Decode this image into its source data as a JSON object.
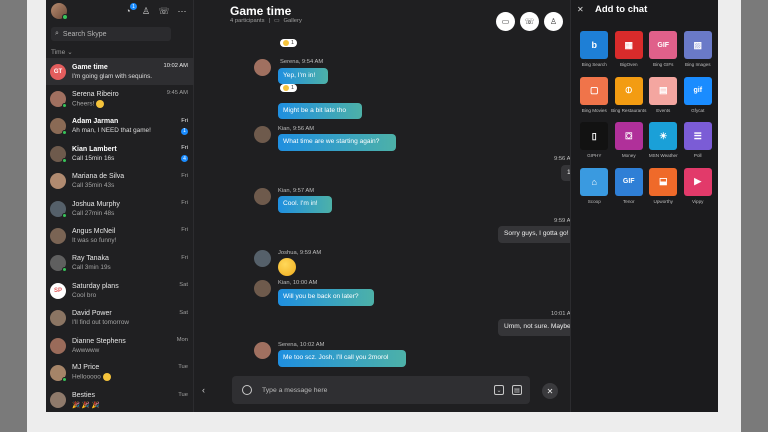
{
  "sidebar": {
    "search_placeholder": "Search Skype",
    "sort_label": "Time",
    "notification_count": "1",
    "chats": [
      {
        "name": "Game time",
        "preview": "I'm going glam with sequins.",
        "time": "10:02 AM",
        "initials": "GT",
        "avatar_color": "#e35d5d",
        "bold": true,
        "active": true,
        "badge": "",
        "online": false
      },
      {
        "name": "Serena Ribeiro",
        "preview": "Cheers!",
        "time": "9:45 AM",
        "initials": "",
        "avatar_color": "#a07060",
        "bold": false,
        "active": false,
        "badge": "",
        "online": true,
        "emoji": true
      },
      {
        "name": "Adam Jarman",
        "preview": "Ah man, I NEED that game!",
        "time": "Fri",
        "initials": "",
        "avatar_color": "#8a6a55",
        "bold": true,
        "active": false,
        "badge": "1",
        "online": true
      },
      {
        "name": "Kian Lambert",
        "preview": "Call 15min 16s",
        "time": "Fri",
        "initials": "",
        "avatar_color": "#6e5a4c",
        "bold": true,
        "active": false,
        "badge": "4",
        "online": true
      },
      {
        "name": "Mariana de Silva",
        "preview": "Call 35min 43s",
        "time": "Fri",
        "initials": "",
        "avatar_color": "#b08a70",
        "bold": false,
        "active": false,
        "badge": "",
        "online": false
      },
      {
        "name": "Joshua Murphy",
        "preview": "Call 27min 48s",
        "time": "Fri",
        "initials": "",
        "avatar_color": "#55606a",
        "bold": false,
        "active": false,
        "badge": "",
        "online": true
      },
      {
        "name": "Angus McNeil",
        "preview": "It was so funny!",
        "time": "Fri",
        "initials": "",
        "avatar_color": "#7a6454",
        "bold": false,
        "active": false,
        "badge": "",
        "online": false
      },
      {
        "name": "Ray Tanaka",
        "preview": "Call 3min 19s",
        "time": "Fri",
        "initials": "",
        "avatar_color": "#5f5f5f",
        "bold": false,
        "active": false,
        "badge": "",
        "online": true
      },
      {
        "name": "Saturday plans",
        "preview": "Cool bro",
        "time": "Sat",
        "initials": "SP",
        "avatar_color": "#ffffff",
        "bold": false,
        "active": false,
        "badge": "",
        "online": false,
        "initials_color": "#e35d5d"
      },
      {
        "name": "David Power",
        "preview": "I'll find out tomorrow",
        "time": "Sat",
        "initials": "",
        "avatar_color": "#8b7563",
        "bold": false,
        "active": false,
        "badge": "",
        "online": false
      },
      {
        "name": "Dianne Stephens",
        "preview": "Awwwww",
        "time": "Mon",
        "initials": "",
        "avatar_color": "#9a6b5a",
        "bold": false,
        "active": false,
        "badge": "",
        "online": false
      },
      {
        "name": "MJ Price",
        "preview": "Hellooooo",
        "time": "Tue",
        "initials": "",
        "avatar_color": "#a58468",
        "bold": false,
        "active": false,
        "badge": "",
        "online": true,
        "emoji": true
      },
      {
        "name": "Besties",
        "preview": "🎉 🎉 🎉",
        "time": "Tue",
        "initials": "",
        "avatar_color": "#8f7a6b",
        "bold": false,
        "active": false,
        "badge": "",
        "online": false
      }
    ]
  },
  "conversation": {
    "title": "Game time",
    "participants": "4 participants",
    "gallery": "Gallery",
    "composer_placeholder": "Type a message here",
    "reaction_count": "1",
    "messages": [
      {
        "sender": "Serena, 9:54 AM",
        "texts": [
          "Yep, I'm in!",
          "Might be a bit late tho"
        ]
      },
      {
        "sender": "Kian, 9:56 AM",
        "texts": [
          "What time are we starting again?"
        ]
      },
      {
        "sender": "9:56 AM",
        "texts": [
          "1"
        ],
        "outgoing": true
      },
      {
        "sender": "Kian, 9:57 AM",
        "texts": [
          "Cool. I'm in!"
        ]
      },
      {
        "sender": "9:59 AM",
        "texts": [
          "Sorry guys, I gotta go!"
        ],
        "outgoing": true
      },
      {
        "sender": "Joshua, 9:59 AM",
        "texts": []
      },
      {
        "sender": "Kian, 10:00 AM",
        "texts": [
          "Will you be back on later?"
        ]
      },
      {
        "sender": "10:01 AM",
        "texts": [
          "Umm, not sure. Maybe"
        ],
        "outgoing": true
      },
      {
        "sender": "Serena, 10:02 AM",
        "texts": [
          "Me too scz. Josh, I'll call you 2morol"
        ]
      }
    ]
  },
  "panel": {
    "title": "Add to chat",
    "apps": [
      {
        "label": "Bing Search",
        "glyph": "b",
        "color": "#1e7fd6"
      },
      {
        "label": "BigOven",
        "glyph": "▦",
        "color": "#d92b2b"
      },
      {
        "label": "Bing GIFs",
        "glyph": "GIF",
        "color": "#e0608a"
      },
      {
        "label": "Bing Images",
        "glyph": "▨",
        "color": "#6a7ac8"
      },
      {
        "label": "Bing Movies",
        "glyph": "▢",
        "color": "#f0744a"
      },
      {
        "label": "Bing Restaurants",
        "glyph": "⦶",
        "color": "#f39c12"
      },
      {
        "label": "Events",
        "glyph": "▤",
        "color": "#f4a6a0"
      },
      {
        "label": "Gfycat",
        "glyph": "gif",
        "color": "#1a8cff"
      },
      {
        "label": "GIPHY",
        "glyph": "▯",
        "color": "#121212"
      },
      {
        "label": "Money",
        "glyph": "⛋",
        "color": "#b0309a"
      },
      {
        "label": "MSN Weather",
        "glyph": "☀",
        "color": "#1aa0d8"
      },
      {
        "label": "Poll",
        "glyph": "☰",
        "color": "#7b5cd6"
      },
      {
        "label": "Scoop",
        "glyph": "⌂",
        "color": "#3a9ae0"
      },
      {
        "label": "Tenor",
        "glyph": "GIF",
        "color": "#2f7fd6"
      },
      {
        "label": "Upworthy",
        "glyph": "⬓",
        "color": "#ef6a2a"
      },
      {
        "label": "Vippy",
        "glyph": "▶",
        "color": "#e23a6a"
      }
    ]
  }
}
